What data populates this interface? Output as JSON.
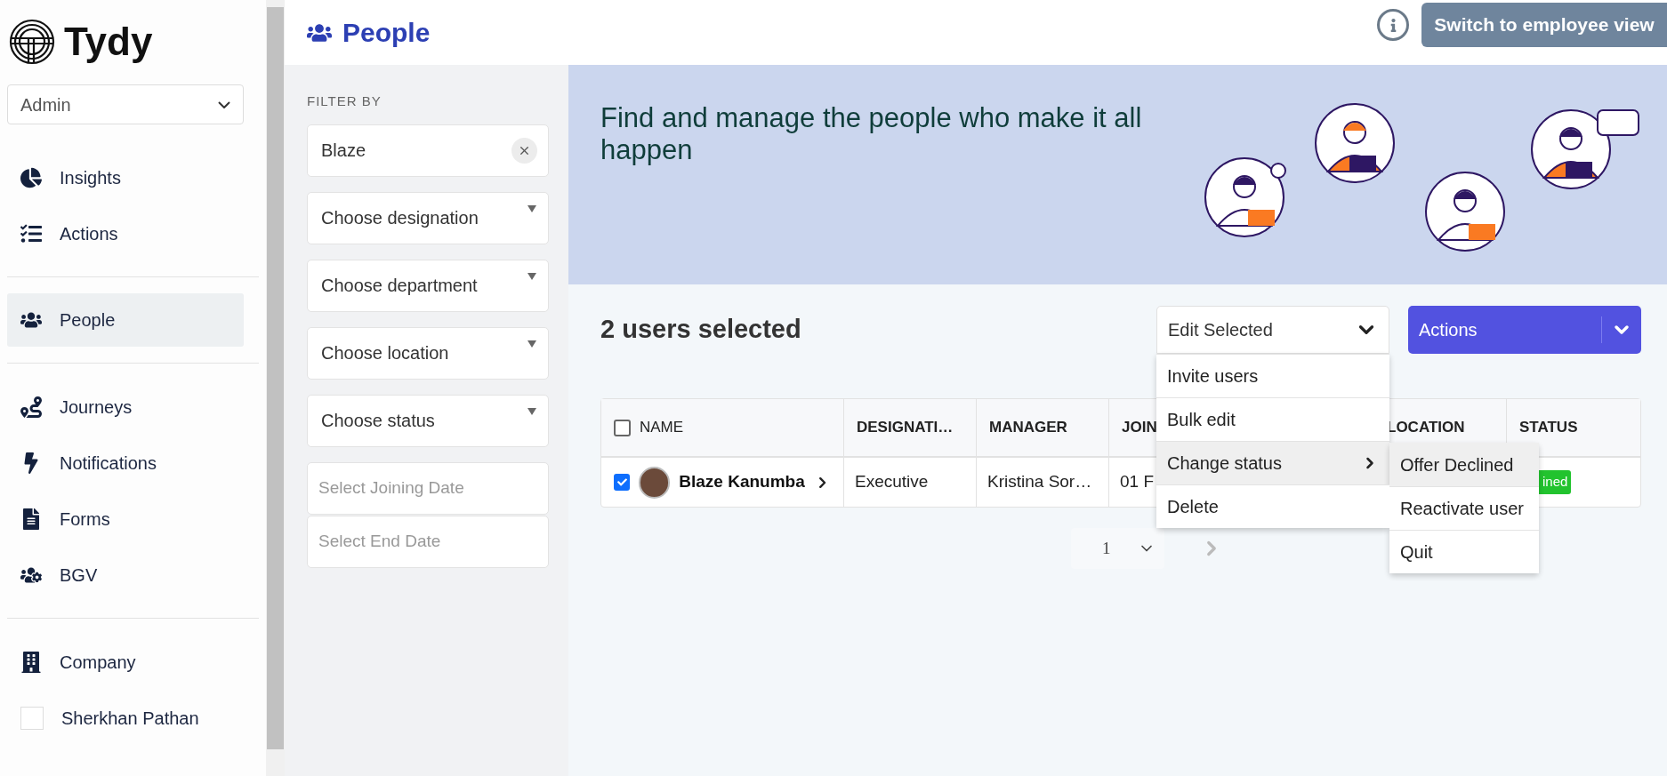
{
  "brand": {
    "name": "Tydy"
  },
  "role_select": {
    "value": "Admin"
  },
  "nav_groups": [
    {
      "items": [
        {
          "label": "Insights",
          "selected": false
        },
        {
          "label": "Actions",
          "selected": false
        }
      ]
    },
    {
      "items": [
        {
          "label": "People",
          "selected": true
        }
      ]
    },
    {
      "items": [
        {
          "label": "Journeys",
          "selected": false
        },
        {
          "label": "Notifications",
          "selected": false
        },
        {
          "label": "Forms",
          "selected": false
        },
        {
          "label": "BGV",
          "selected": false
        }
      ]
    },
    {
      "items": [
        {
          "label": "Company",
          "selected": false,
          "kind": "icon"
        },
        {
          "label": "Sherkhan Pathan",
          "selected": false,
          "kind": "avatar"
        }
      ]
    }
  ],
  "header": {
    "title": "People",
    "switch_button": "Switch to employee view"
  },
  "filters": {
    "heading": "FILTER BY",
    "search": {
      "value": "Blaze"
    },
    "selects": [
      {
        "label": "Choose designation"
      },
      {
        "label": "Choose department"
      },
      {
        "label": "Choose location"
      },
      {
        "label": "Choose status"
      }
    ],
    "dates": [
      {
        "placeholder": "Select Joining Date"
      },
      {
        "placeholder": "Select End Date"
      }
    ]
  },
  "banner": {
    "text": "Find and manage the people who make it all happen"
  },
  "selection": {
    "summary": "2 users selected"
  },
  "edit_menu": {
    "label": "Edit Selected",
    "expanded": true,
    "items": [
      {
        "label": "Invite users",
        "selected": false
      },
      {
        "label": "Bulk edit",
        "selected": false
      },
      {
        "label": "Change status",
        "selected": true,
        "submenu": [
          {
            "label": "Offer Declined",
            "selected": true
          },
          {
            "label": "Reactivate user",
            "selected": false
          },
          {
            "label": "Quit",
            "selected": false
          }
        ]
      },
      {
        "label": "Delete",
        "selected": false
      }
    ]
  },
  "actions_button": {
    "label": "Actions"
  },
  "table": {
    "all_checked": false,
    "columns": [
      "NAME",
      "DESIGNATI…",
      "MANAGER",
      "JOIN",
      "LOCATION",
      "STATUS"
    ],
    "rows": [
      {
        "checked": true,
        "name": "Blaze Kanumba",
        "designation": "Executive",
        "manager": "Kristina Sor…",
        "joining": "01 F",
        "status": "ined",
        "color": "#22c32e"
      }
    ]
  },
  "pagination": {
    "page": "1"
  }
}
